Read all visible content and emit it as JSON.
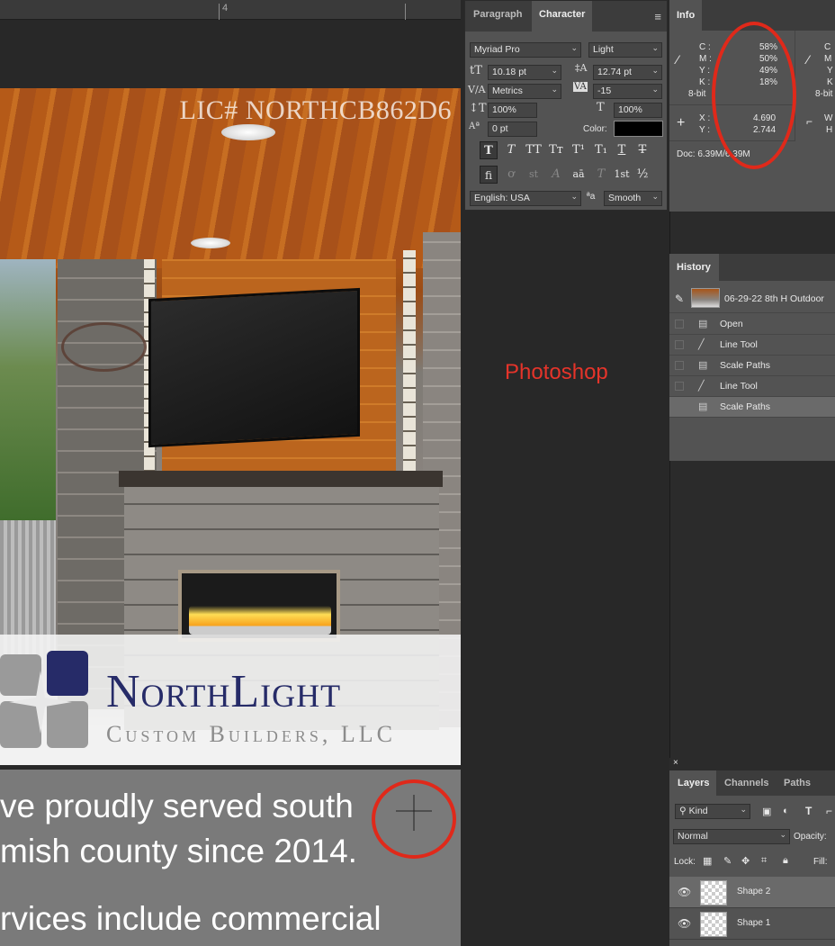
{
  "canvas": {
    "ruler_number": "4",
    "license_text": "LIC# NORTHCB862D6",
    "logo_name": "NorthLight",
    "logo_subtitle": "Custom Builders, LLC",
    "body_lines": [
      "ve proudly served south",
      "mish county since 2014.",
      "rvices include commercial"
    ]
  },
  "annotation": {
    "label": "Photoshop",
    "color": "#e5342a"
  },
  "character_panel": {
    "tabs": [
      "Paragraph",
      "Character"
    ],
    "font_family": "Myriad Pro",
    "font_style": "Light",
    "font_size": "10.18 pt",
    "leading": "12.74 pt",
    "kerning": "Metrics",
    "tracking": "-15",
    "vertical_scale": "100%",
    "horizontal_scale": "100%",
    "baseline_shift": "0 pt",
    "color_label": "Color:",
    "language": "English: USA",
    "aa_label": "ªa",
    "antialias": "Smooth",
    "style_buttons": [
      "T",
      "T",
      "TT",
      "Tт",
      "T¹",
      "T₁",
      "T",
      "T"
    ],
    "opentype_buttons": [
      "fi",
      "ơ",
      "st",
      "A",
      "aā",
      "T",
      "1st",
      "½"
    ]
  },
  "info_panel": {
    "tab": "Info",
    "cmyk_labels": [
      "C :",
      "M :",
      "Y :",
      "K :"
    ],
    "cmyk_values": [
      "58%",
      "50%",
      "49%",
      "18%"
    ],
    "bit_depth": "8-bit",
    "right_cmyk_labels": [
      "C",
      "M",
      "Y",
      "K"
    ],
    "right_bit_depth": "8-bit",
    "x_label": "X :",
    "y_label": "Y :",
    "x_value": "4.690",
    "y_value": "2.744",
    "w_label": "W",
    "h_label": "H",
    "doc": "Doc: 6.39M/6.39M"
  },
  "history_panel": {
    "tab": "History",
    "snapshot": "06-29-22 8th H Outdoor",
    "items": [
      "Open",
      "Line Tool",
      "Scale Paths",
      "Line Tool",
      "Scale Paths"
    ],
    "item_icons": [
      "document-icon",
      "line-icon",
      "document-icon",
      "line-icon",
      "document-icon"
    ]
  },
  "layers_panel": {
    "tabs": [
      "Layers",
      "Channels",
      "Paths"
    ],
    "filter": "Kind",
    "blend_mode": "Normal",
    "opacity_label": "Opacity:",
    "lock_label": "Lock:",
    "fill_label": "Fill:",
    "layers": [
      "Shape 2",
      "Shape 1"
    ]
  }
}
